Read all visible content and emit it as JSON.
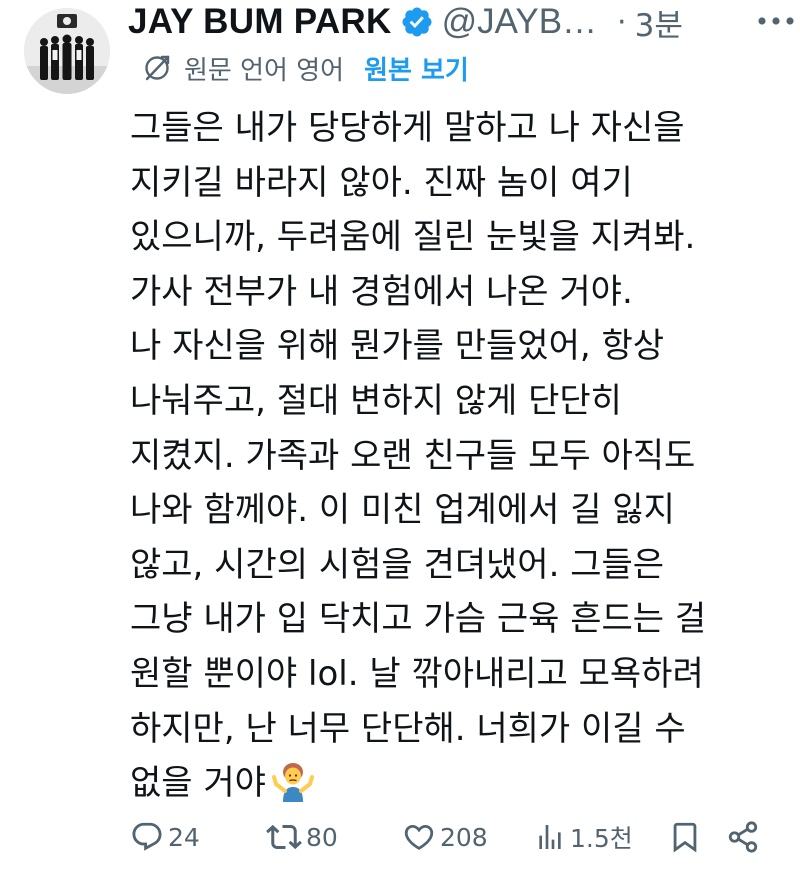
{
  "author": {
    "display_name": "JAY BUM PARK",
    "handle": "@JAYB…",
    "verified": true,
    "avatar_icon": "group-photo-avatar"
  },
  "timestamp": "3분",
  "separator": "·",
  "translation": {
    "icon": "translate-icon",
    "label": "원문 언어 영어",
    "show_original": "원본 보기"
  },
  "tweet_lines": [
    "그들은 내가 당당하게 말하고 나 자신을",
    "지키길 바라지 않아. 진짜 놈이 여기",
    "있으니까, 두려움에 질린 눈빛을 지켜봐.",
    "가사 전부가 내 경험에서 나온 거야.",
    "나 자신을 위해 뭔가를 만들었어, 항상",
    "나눠주고, 절대 변하지 않게 단단히",
    "지켰지. 가족과 오랜 친구들 모두 아직도",
    "나와 함께야. 이 미친 업계에서 길 잃지",
    "않고, 시간의 시험을 견뎌냈어. 그들은",
    "그냥 내가 입 닥치고 가슴 근육 흔드는 걸",
    "원할 뿐이야 lol. 날 깎아내리고 모욕하려",
    "하지만, 난 너무 단단해. 너희가 이길 수",
    "없을 거야"
  ],
  "tweet_emoji": "person-shrugging-emoji",
  "metrics": {
    "replies": "24",
    "reposts": "80",
    "likes": "208",
    "views": "1.5천"
  },
  "colors": {
    "text": "#0f1419",
    "secondary": "#536471",
    "accent": "#1d9bf0"
  }
}
